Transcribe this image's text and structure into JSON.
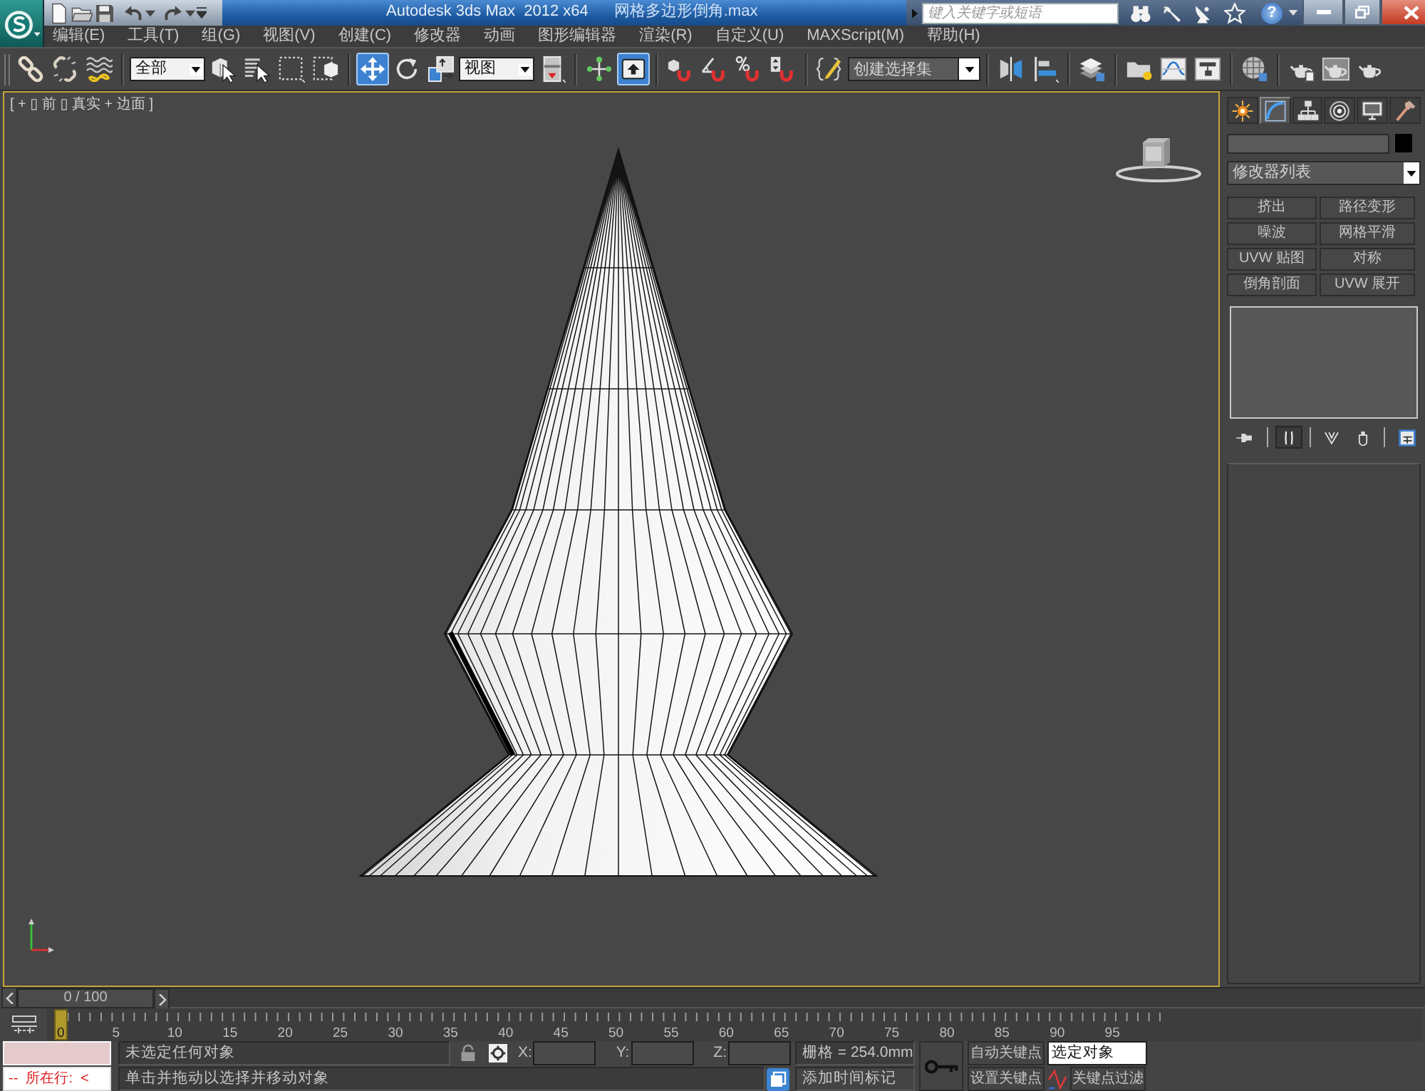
{
  "title_bar": {
    "app_title": "Autodesk 3ds Max  2012 x64",
    "file_name": "网格多边形倒角.max",
    "search": {
      "placeholder": "键入关键字或短语"
    },
    "help_button": "?"
  },
  "menu_bar": [
    "编辑(E)",
    "工具(T)",
    "组(G)",
    "视图(V)",
    "创建(C)",
    "修改器",
    "动画",
    "图形编辑器",
    "渲染(R)",
    "自定义(U)",
    "MAXScript(M)",
    "帮助(H)"
  ],
  "main_toolbar": [
    {
      "kind": "tool",
      "selected": false
    },
    {
      "kind": "tool",
      "selected": false
    },
    {
      "kind": "tool",
      "selected": false
    },
    {
      "kind": "separator"
    },
    {
      "kind": "dropdown",
      "value": "全部"
    },
    {
      "kind": "tool",
      "selected": false
    },
    {
      "kind": "tool",
      "selected": false
    },
    {
      "kind": "tool",
      "selected": false
    },
    {
      "kind": "tool",
      "selected": false
    },
    {
      "kind": "separator"
    },
    {
      "kind": "tool",
      "selected": true
    },
    {
      "kind": "tool",
      "selected": false
    },
    {
      "kind": "tool",
      "selected": false
    },
    {
      "kind": "dropdown",
      "value": "视图"
    },
    {
      "kind": "tool",
      "selected": false
    },
    {
      "kind": "separator"
    },
    {
      "kind": "tool",
      "selected": false
    },
    {
      "kind": "tool",
      "selected": true
    },
    {
      "kind": "separator"
    },
    {
      "kind": "tool",
      "selected": false
    },
    {
      "kind": "tool",
      "selected": false
    },
    {
      "kind": "tool",
      "selected": false
    },
    {
      "kind": "tool",
      "selected": false
    },
    {
      "kind": "separator"
    },
    {
      "kind": "tool",
      "selected": false
    },
    {
      "kind": "combo",
      "placeholder": "创建选择集"
    },
    {
      "kind": "separator"
    },
    {
      "kind": "tool",
      "selected": false
    },
    {
      "kind": "tool",
      "selected": false
    },
    {
      "kind": "separator"
    },
    {
      "kind": "tool",
      "selected": false
    },
    {
      "kind": "separator"
    },
    {
      "kind": "tool",
      "selected": false
    },
    {
      "kind": "tool",
      "selected": false
    },
    {
      "kind": "tool",
      "selected": false
    },
    {
      "kind": "separator"
    },
    {
      "kind": "tool",
      "selected": false
    },
    {
      "kind": "separator"
    },
    {
      "kind": "tool",
      "selected": false
    },
    {
      "kind": "tool",
      "selected": false
    },
    {
      "kind": "tool",
      "selected": false
    }
  ],
  "viewport": {
    "label": "[ + ▯ 前 ▯ 真实 + 边面 ]",
    "active": true
  },
  "command_panel": {
    "tabs": [
      {
        "selected": false
      },
      {
        "selected": true
      },
      {
        "selected": false
      },
      {
        "selected": false
      },
      {
        "selected": false
      },
      {
        "selected": false
      }
    ],
    "modifier_list": "修改器列表",
    "modifier_buttons": [
      "挤出",
      "路径变形",
      "噪波",
      "网格平滑",
      "UVW 贴图",
      "对称",
      "倒角剖面",
      "UVW 展开"
    ],
    "stack_toolbar": [
      {
        "kind": "tool",
        "on": false
      },
      {
        "kind": "separator"
      },
      {
        "kind": "tool",
        "on": true
      },
      {
        "kind": "separator"
      },
      {
        "kind": "tool",
        "on": false
      },
      {
        "kind": "tool",
        "on": false
      },
      {
        "kind": "separator"
      },
      {
        "kind": "tool",
        "on": false
      }
    ]
  },
  "time_slider": {
    "label": "0 / 100",
    "level": 0
  },
  "track_bar": {
    "ticks": [
      "0",
      "5",
      "10",
      "15",
      "20",
      "25",
      "30",
      "35",
      "40",
      "45",
      "50",
      "55",
      "60",
      "65",
      "70",
      "75",
      "80",
      "85",
      "90",
      "95"
    ]
  },
  "status_bar": {
    "listener_output": "--  所在行:  <",
    "selection_status": "未选定任何对象",
    "coordinates": [
      {
        "label": "X:"
      },
      {
        "label": "Y:"
      },
      {
        "label": "Z:"
      }
    ],
    "grid": "栅格 = 254.0mm",
    "auto_key": "自动关键点",
    "key_mode": "选定对象",
    "prompt": "单击并拖动以选择并移动对象",
    "time_tag": "添加时间标记",
    "set_key": "设置关键点",
    "key_filters": "关键点过滤"
  }
}
